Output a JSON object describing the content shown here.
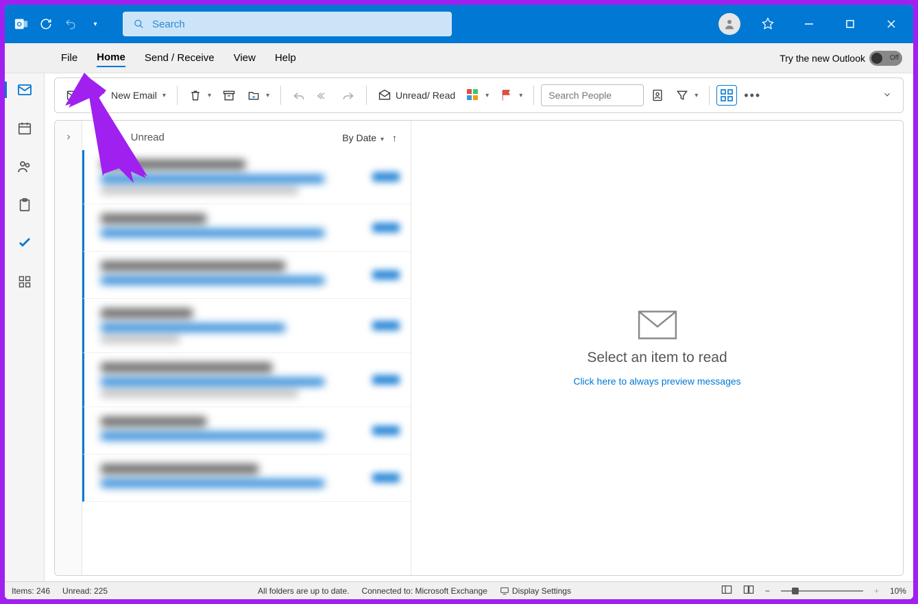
{
  "titlebar": {
    "search_placeholder": "Search"
  },
  "menubar": {
    "file": "File",
    "home": "Home",
    "send_receive": "Send / Receive",
    "view": "View",
    "help": "Help",
    "try_new": "Try the new Outlook",
    "toggle_off": "Off"
  },
  "ribbon": {
    "new_email": "New Email",
    "unread_read": "Unread/ Read",
    "search_people_placeholder": "Search People"
  },
  "msglist": {
    "all": "All",
    "unread": "Unread",
    "by_date": "By Date"
  },
  "reading": {
    "select_item": "Select an item to read",
    "preview_link": "Click here to always preview messages"
  },
  "statusbar": {
    "items": "Items: 246",
    "unread": "Unread: 225",
    "folders": "All folders are up to date.",
    "connected": "Connected to: Microsoft Exchange",
    "display_settings": "Display Settings",
    "zoom": "10%"
  }
}
